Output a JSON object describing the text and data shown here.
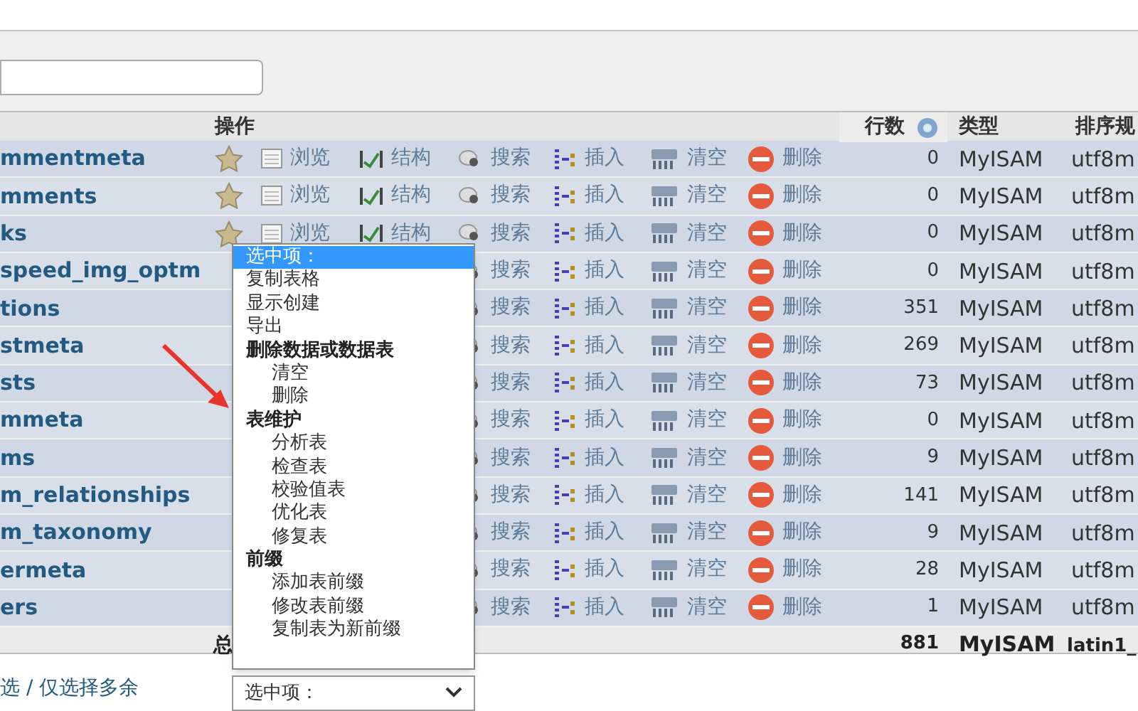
{
  "table": {
    "columns": [
      {
        "label": "操作"
      },
      {
        "label": "行数",
        "help": true
      },
      {
        "label": "类型"
      },
      {
        "label": "排序规"
      }
    ],
    "rows": [
      {
        "name": "mmentmeta",
        "actions": [
          {
            "kind": "favorite"
          },
          {
            "kind": "browse",
            "label": "浏览"
          },
          {
            "kind": "structure",
            "label": "结构"
          },
          {
            "kind": "search",
            "label": "搜索"
          },
          {
            "kind": "insert",
            "label": "插入"
          },
          {
            "kind": "empty",
            "label": "清空"
          },
          {
            "kind": "drop",
            "label": "删除"
          }
        ],
        "rows": "0",
        "type": "MyISAM",
        "collation": "utf8m"
      },
      {
        "name": "mments",
        "actions": [
          {
            "kind": "favorite"
          },
          {
            "kind": "browse",
            "label": "浏览"
          },
          {
            "kind": "structure",
            "label": "结构"
          },
          {
            "kind": "search",
            "label": "搜索"
          },
          {
            "kind": "insert",
            "label": "插入"
          },
          {
            "kind": "empty",
            "label": "清空"
          },
          {
            "kind": "drop",
            "label": "删除"
          }
        ],
        "rows": "0",
        "type": "MyISAM",
        "collation": "utf8m"
      },
      {
        "name": "ks",
        "actions": [
          {
            "kind": "favorite"
          },
          {
            "kind": "browse",
            "label": "浏览"
          },
          {
            "kind": "structure",
            "label": "结构"
          },
          {
            "kind": "search",
            "label": "搜索"
          },
          {
            "kind": "insert",
            "label": "插入"
          },
          {
            "kind": "empty",
            "label": "清空"
          },
          {
            "kind": "drop",
            "label": "删除"
          }
        ],
        "rows": "0",
        "type": "MyISAM",
        "collation": "utf8m"
      },
      {
        "name": "speed_img_optm",
        "actions": [
          {
            "kind": "search",
            "label": "搜索"
          },
          {
            "kind": "insert",
            "label": "插入"
          },
          {
            "kind": "empty",
            "label": "清空"
          },
          {
            "kind": "drop",
            "label": "删除"
          }
        ],
        "rows": "0",
        "type": "MyISAM",
        "collation": "utf8m"
      },
      {
        "name": "tions",
        "actions": [
          {
            "kind": "search",
            "label": "搜索"
          },
          {
            "kind": "insert",
            "label": "插入"
          },
          {
            "kind": "empty",
            "label": "清空"
          },
          {
            "kind": "drop",
            "label": "删除"
          }
        ],
        "rows": "351",
        "type": "MyISAM",
        "collation": "utf8m"
      },
      {
        "name": "stmeta",
        "actions": [
          {
            "kind": "search",
            "label": "搜索"
          },
          {
            "kind": "insert",
            "label": "插入"
          },
          {
            "kind": "empty",
            "label": "清空"
          },
          {
            "kind": "drop",
            "label": "删除"
          }
        ],
        "rows": "269",
        "type": "MyISAM",
        "collation": "utf8m"
      },
      {
        "name": "sts",
        "actions": [
          {
            "kind": "search",
            "label": "搜索"
          },
          {
            "kind": "insert",
            "label": "插入"
          },
          {
            "kind": "empty",
            "label": "清空"
          },
          {
            "kind": "drop",
            "label": "删除"
          }
        ],
        "rows": "73",
        "type": "MyISAM",
        "collation": "utf8m"
      },
      {
        "name": "mmeta",
        "actions": [
          {
            "kind": "search",
            "label": "搜索"
          },
          {
            "kind": "insert",
            "label": "插入"
          },
          {
            "kind": "empty",
            "label": "清空"
          },
          {
            "kind": "drop",
            "label": "删除"
          }
        ],
        "rows": "0",
        "type": "MyISAM",
        "collation": "utf8m"
      },
      {
        "name": "ms",
        "actions": [
          {
            "kind": "search",
            "label": "搜索"
          },
          {
            "kind": "insert",
            "label": "插入"
          },
          {
            "kind": "empty",
            "label": "清空"
          },
          {
            "kind": "drop",
            "label": "删除"
          }
        ],
        "rows": "9",
        "type": "MyISAM",
        "collation": "utf8m"
      },
      {
        "name": "m_relationships",
        "actions": [
          {
            "kind": "search",
            "label": "搜索"
          },
          {
            "kind": "insert",
            "label": "插入"
          },
          {
            "kind": "empty",
            "label": "清空"
          },
          {
            "kind": "drop",
            "label": "删除"
          }
        ],
        "rows": "141",
        "type": "MyISAM",
        "collation": "utf8m"
      },
      {
        "name": "m_taxonomy",
        "actions": [
          {
            "kind": "search",
            "label": "搜索"
          },
          {
            "kind": "insert",
            "label": "插入"
          },
          {
            "kind": "empty",
            "label": "清空"
          },
          {
            "kind": "drop",
            "label": "删除"
          }
        ],
        "rows": "9",
        "type": "MyISAM",
        "collation": "utf8m"
      },
      {
        "name": "ermeta",
        "actions": [
          {
            "kind": "search",
            "label": "搜索"
          },
          {
            "kind": "insert",
            "label": "插入"
          },
          {
            "kind": "empty",
            "label": "清空"
          },
          {
            "kind": "drop",
            "label": "删除"
          }
        ],
        "rows": "28",
        "type": "MyISAM",
        "collation": "utf8m"
      },
      {
        "name": "ers",
        "actions": [
          {
            "kind": "search",
            "label": "搜索"
          },
          {
            "kind": "insert",
            "label": "插入"
          },
          {
            "kind": "empty",
            "label": "清空"
          },
          {
            "kind": "drop",
            "label": "删除"
          }
        ],
        "rows": "1",
        "type": "MyISAM",
        "collation": "utf8m"
      }
    ],
    "footer": {
      "label": "总",
      "rows": "881",
      "type": "MyISAM",
      "collation": "latin1_"
    }
  },
  "bottom": {
    "check_links": "选 / 仅选择多余",
    "select": {
      "value": "选中项："
    }
  },
  "dropdown": {
    "items": [
      {
        "kind": "option",
        "label": "选中项：",
        "selected": true
      },
      {
        "kind": "option",
        "label": "复制表格",
        "selected": false
      },
      {
        "kind": "option",
        "label": "显示创建",
        "selected": false
      },
      {
        "kind": "option",
        "label": "导出",
        "selected": false
      },
      {
        "kind": "group",
        "label": "删除数据或数据表",
        "children": [
          {
            "label": "清空",
            "selected": false
          },
          {
            "label": "删除",
            "selected": false
          }
        ]
      },
      {
        "kind": "group",
        "label": "表维护",
        "children": [
          {
            "label": "分析表",
            "selected": false
          },
          {
            "label": "检查表",
            "selected": false
          },
          {
            "label": "校验值表",
            "selected": false
          },
          {
            "label": "优化表",
            "selected": false
          },
          {
            "label": "修复表",
            "selected": false
          }
        ]
      },
      {
        "kind": "group",
        "label": "前缀",
        "children": [
          {
            "label": "添加表前缀",
            "selected": false
          },
          {
            "label": "修改表前缀",
            "selected": false
          },
          {
            "label": "复制表为新前缀",
            "selected": false
          }
        ]
      }
    ]
  }
}
